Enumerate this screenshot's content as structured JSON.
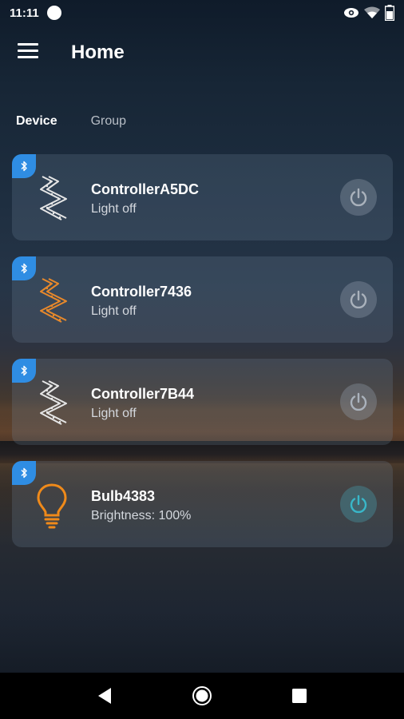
{
  "status_bar": {
    "time": "11:11"
  },
  "app_bar": {
    "title": "Home",
    "menu_icon": "hamburger-menu-icon"
  },
  "tabs": [
    {
      "label": "Device",
      "active": true
    },
    {
      "label": "Group",
      "active": false
    }
  ],
  "devices": [
    {
      "name": "ControllerA5DC",
      "status": "Light off",
      "type": "strip",
      "icon": "led-strip-icon",
      "icon_color": "#e6e6e6",
      "power_on": false
    },
    {
      "name": "Controller7436",
      "status": "Light off",
      "type": "strip",
      "icon": "led-strip-icon",
      "icon_color": "#e8892b",
      "power_on": false
    },
    {
      "name": "Controller7B44",
      "status": "Light off",
      "type": "strip",
      "icon": "led-strip-icon",
      "icon_color": "#e6e6e6",
      "power_on": false
    },
    {
      "name": "Bulb4383",
      "status": "Brightness: 100%",
      "type": "bulb",
      "icon": "light-bulb-icon",
      "icon_color": "#f08a1a",
      "power_on": true
    }
  ],
  "colors": {
    "bluetooth_badge": "#2f8de3",
    "power_off": "#aab2bc",
    "power_on": "#39b7c9"
  },
  "nav_bar": {
    "back_icon": "back-triangle-icon",
    "home_icon": "home-circle-icon",
    "recents_icon": "recents-square-icon"
  }
}
